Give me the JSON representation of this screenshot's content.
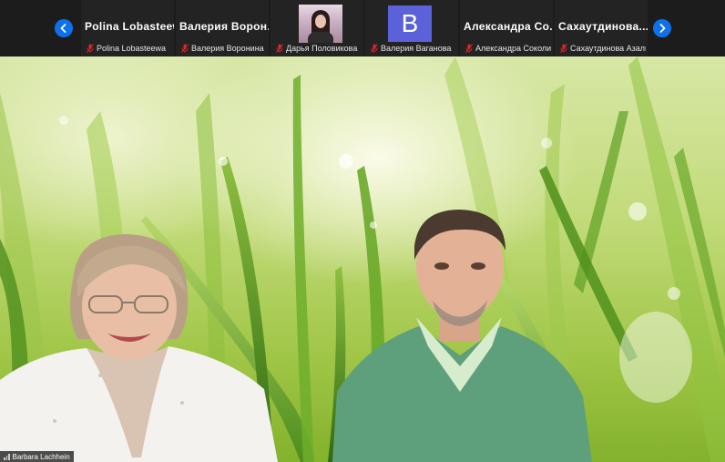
{
  "participants_strip": {
    "prev_label": "‹",
    "next_label": "›",
    "tiles": [
      {
        "display_name": "Polina  Lobasteew...",
        "label": "Polina Lobasteewa"
      },
      {
        "display_name": "Валерия  Ворон...",
        "label": "Валерия Воронина"
      },
      {
        "display_name": "",
        "label": "Дарья Половикова"
      },
      {
        "display_name": "",
        "avatar_letter": "B",
        "label": "Валерия Ваганова"
      },
      {
        "display_name": "Александра  Со...",
        "label": "Александра Соколихи..."
      },
      {
        "display_name": "Сахаутдинова...",
        "label": "Сахаутдинова Азалия"
      }
    ]
  },
  "main_video": {
    "speaker_label": "Barbara Lachhein"
  },
  "colors": {
    "accent": "#0e71eb",
    "muted_mic": "#e02828",
    "avatar_bg": "#5b61d8"
  }
}
